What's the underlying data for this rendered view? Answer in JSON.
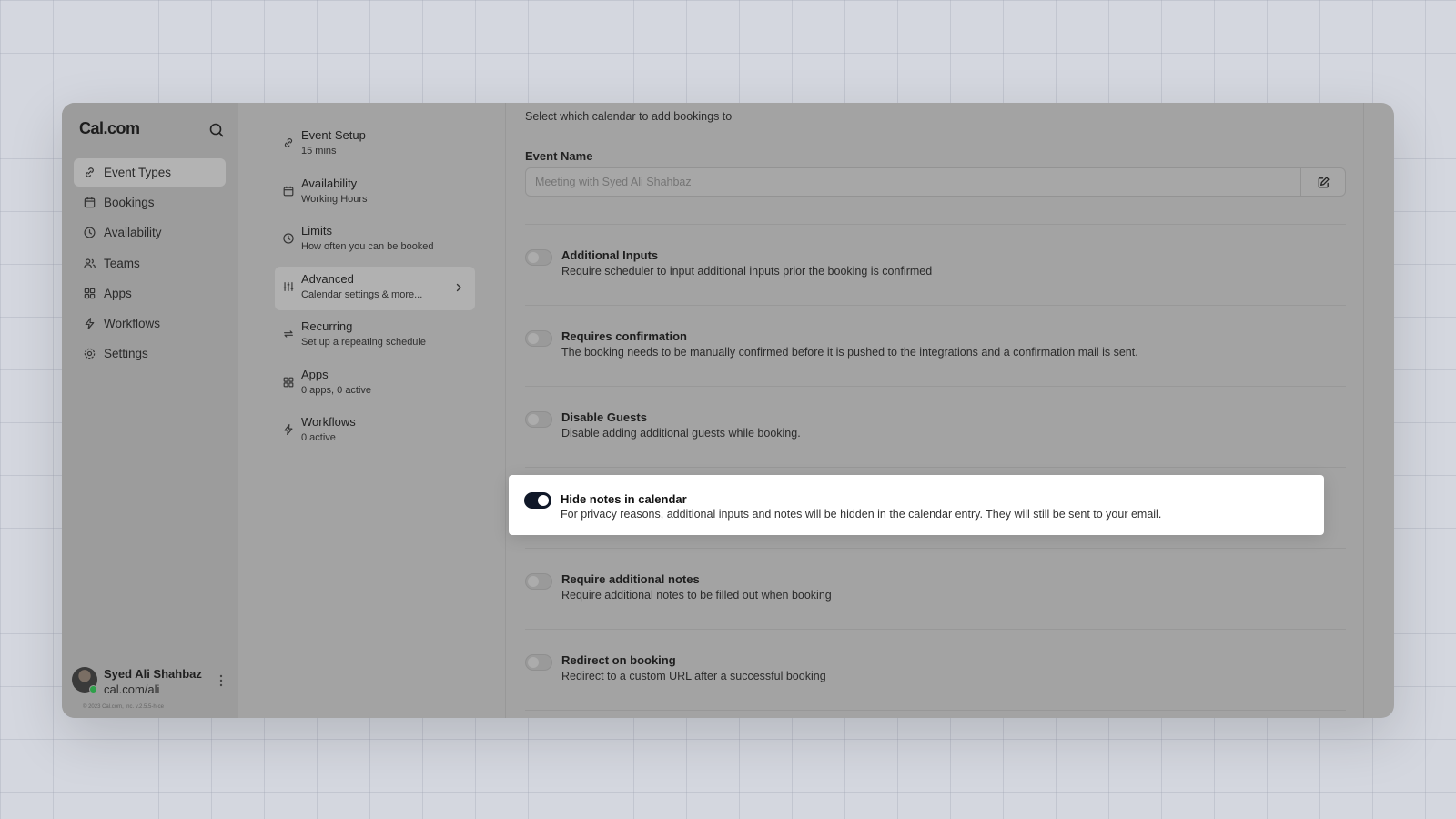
{
  "app": {
    "logo": "Cal.com"
  },
  "sidebar": {
    "items": [
      {
        "label": "Event Types",
        "icon": "link-icon",
        "active": true
      },
      {
        "label": "Bookings",
        "icon": "calendar-icon"
      },
      {
        "label": "Availability",
        "icon": "clock-icon"
      },
      {
        "label": "Teams",
        "icon": "users-icon"
      },
      {
        "label": "Apps",
        "icon": "grid-icon"
      },
      {
        "label": "Workflows",
        "icon": "bolt-icon"
      },
      {
        "label": "Settings",
        "icon": "gear-icon"
      }
    ],
    "profile": {
      "name": "Syed Ali Shahbaz",
      "url": "cal.com/ali"
    },
    "copyright": "© 2023 Cal.com, Inc. v.2.5.5-h-ce"
  },
  "subnav": {
    "items": [
      {
        "title": "Event Setup",
        "desc": "15 mins",
        "icon": "link-icon"
      },
      {
        "title": "Availability",
        "desc": "Working Hours",
        "icon": "calendar-icon"
      },
      {
        "title": "Limits",
        "desc": "How often you can be booked",
        "icon": "clock-icon"
      },
      {
        "title": "Advanced",
        "desc": "Calendar settings & more...",
        "icon": "sliders-icon",
        "active": true
      },
      {
        "title": "Recurring",
        "desc": "Set up a repeating schedule",
        "icon": "repeat-icon"
      },
      {
        "title": "Apps",
        "desc": "0 apps, 0 active",
        "icon": "grid-icon"
      },
      {
        "title": "Workflows",
        "desc": "0 active",
        "icon": "bolt-icon"
      }
    ]
  },
  "main": {
    "intro": "Select which calendar to add bookings to",
    "event_name_label": "Event Name",
    "event_name_placeholder": "Meeting with Syed Ali Shahbaz",
    "settings": [
      {
        "title": "Additional Inputs",
        "desc": "Require scheduler to input additional inputs prior the booking is confirmed",
        "enabled": false
      },
      {
        "title": "Requires confirmation",
        "desc": "The booking needs to be manually confirmed before it is pushed to the integrations and a confirmation mail is sent.",
        "enabled": false
      },
      {
        "title": "Disable Guests",
        "desc": "Disable adding additional guests while booking.",
        "enabled": false
      },
      {
        "title": "Hide notes in calendar",
        "desc": "For privacy reasons, additional inputs and notes will be hidden in the calendar entry. They will still be sent to your email.",
        "enabled": true
      },
      {
        "title": "Require additional notes",
        "desc": "Require additional notes to be filled out when booking",
        "enabled": false
      },
      {
        "title": "Redirect on booking",
        "desc": "Redirect to a custom URL after a successful booking",
        "enabled": false
      }
    ]
  },
  "colors": {
    "toggle_on": "#101828",
    "overlay": "#a3a3a3",
    "highlight_bg": "#ffffff"
  }
}
